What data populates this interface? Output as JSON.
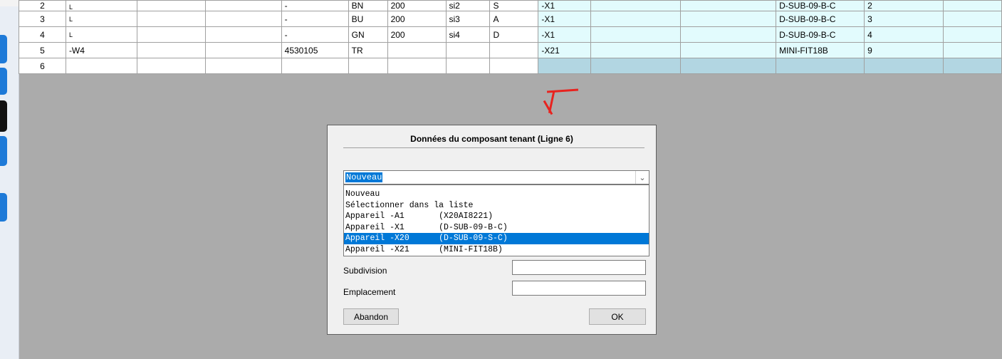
{
  "sheet": {
    "rows": [
      {
        "num": "2",
        "a": "L",
        "b": "",
        "c": "",
        "d": "-",
        "e": "BN",
        "f": "200",
        "g": "si2",
        "h": "S",
        "i": "-X1",
        "j": "",
        "k": "",
        "l": "D-SUB-09-B-C",
        "m": "2",
        "n": ""
      },
      {
        "num": "3",
        "a": "L",
        "b": "",
        "c": "",
        "d": "-",
        "e": "BU",
        "f": "200",
        "g": "si3",
        "h": "A",
        "i": "-X1",
        "j": "",
        "k": "",
        "l": "D-SUB-09-B-C",
        "m": "3",
        "n": ""
      },
      {
        "num": "4",
        "a": "L",
        "b": "",
        "c": "",
        "d": "-",
        "e": "GN",
        "f": "200",
        "g": "si4",
        "h": "D",
        "i": "-X1",
        "j": "",
        "k": "",
        "l": "D-SUB-09-B-C",
        "m": "4",
        "n": ""
      },
      {
        "num": "5",
        "a": "-W4",
        "b": "",
        "c": "",
        "d": "4530105",
        "e": "TR",
        "f": "",
        "g": "",
        "h": "",
        "i": "-X21",
        "j": "",
        "k": "",
        "l": "MINI-FIT18B",
        "m": "9",
        "n": ""
      },
      {
        "num": "6",
        "a": "",
        "b": "",
        "c": "",
        "d": "",
        "e": "",
        "f": "",
        "g": "",
        "h": "",
        "i": "",
        "j": "",
        "k": "",
        "l": "",
        "m": "",
        "n": ""
      }
    ]
  },
  "dialog": {
    "title": "Données du composant tenant (Ligne 6)",
    "combo_value": "Nouveau",
    "options": [
      "Nouveau",
      "Sélectionner dans la liste",
      "Appareil -A1       (X20AI8221)",
      "Appareil -X1       (D-SUB-09-B-C)",
      "Appareil -X20      (D-SUB-09-S-C)",
      "Appareil -X21      (MINI-FIT18B)"
    ],
    "selected_index": 4,
    "subdivision_label": "Subdivision",
    "subdivision_value": "",
    "emplacement_label": "Emplacement",
    "emplacement_value": "",
    "cancel_label": "Abandon",
    "ok_label": "OK"
  },
  "colors": {
    "annotation": "#e8231f",
    "highlight": "#0078d7",
    "cyan_cell": "#e2fbfd",
    "selected_row_cell": "#b2d6e2"
  }
}
